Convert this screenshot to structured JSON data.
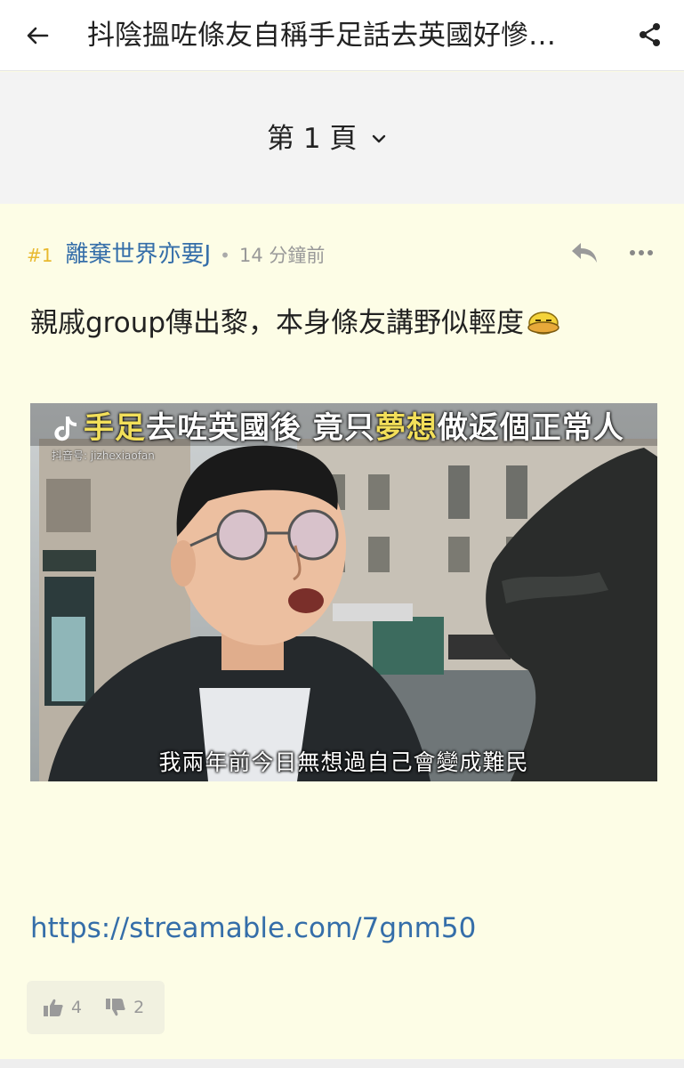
{
  "topbar": {
    "title": "抖陰搵咗條友自稱手足話去英國好慘…",
    "back_icon": "back-arrow-icon",
    "share_icon": "share-icon"
  },
  "pager": {
    "label": "第 1 頁",
    "chevron_icon": "chevron-down-icon"
  },
  "post": {
    "index": "#1",
    "author": "離棄世界亦要J",
    "separator": "•",
    "time": "14 分鐘前",
    "body": "親戚group傳出黎，本身條友講野似輕度",
    "emoji_icon": "face-emoji-icon",
    "video": {
      "title_before": "手足",
      "title_mid": "去咗英國後 竟只",
      "title_highlight": "夢想",
      "title_after": "做返個正常人",
      "watermark": "抖音号: jizhexiaofan",
      "subtitle": "我兩年前今日無想過自己會變成難民"
    },
    "link": "https://streamable.com/7gnm50",
    "likes": "4",
    "dislikes": "2"
  },
  "colors": {
    "post_bg": "#fdfde6",
    "link": "#356ea9",
    "index": "#e8b92f"
  }
}
